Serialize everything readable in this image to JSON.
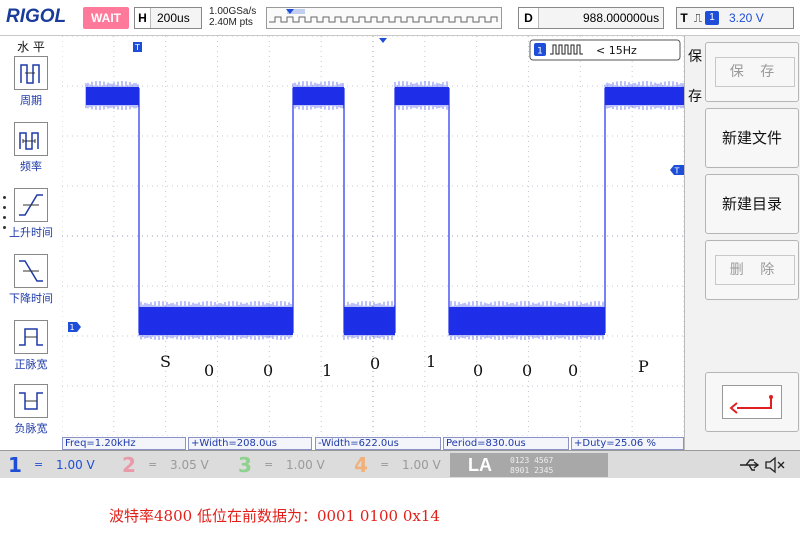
{
  "topbar": {
    "brand": "RIGOL",
    "status": "WAIT",
    "timebase_label": "H",
    "timebase_value": "200us",
    "sample_rate": "1.00GSa/s",
    "mem_depth": "2.40M pts",
    "delay_label": "D",
    "delay_value": "988.000000us",
    "trigger_label": "T",
    "trigger_channel": "1",
    "trigger_level": "3.20 V"
  },
  "left_menu": {
    "title": "水 平",
    "items": [
      {
        "label": "周期",
        "icon": "period-icon"
      },
      {
        "label": "频率",
        "icon": "frequency-icon"
      },
      {
        "label": "上升时间",
        "icon": "rise-time-icon"
      },
      {
        "label": "下降时间",
        "icon": "fall-time-icon"
      },
      {
        "label": "正脉宽",
        "icon": "positive-pulse-icon"
      },
      {
        "label": "负脉宽",
        "icon": "negative-pulse-icon"
      }
    ]
  },
  "screen": {
    "trigger_readout_channel": "1",
    "trigger_readout_text": "< 15Hz",
    "marker_ch1": "1",
    "marker_trigger": "T",
    "decode_chars": [
      "S",
      "0",
      "0",
      "1",
      "0",
      "1",
      "0",
      "0",
      "0",
      "P"
    ],
    "trace_color": "#1e2fe8"
  },
  "measurements": {
    "freq": "Freq=1.20kHz",
    "pwidth": "+Width=208.0us",
    "nwidth": "-Width=622.0us",
    "period": "Period=830.0us",
    "duty": "+Duty=25.06 %"
  },
  "right_menu": {
    "side_title_1": "保",
    "side_title_2": "存",
    "save": "保 存",
    "new_file": "新建文件",
    "new_dir": "新建目录",
    "delete": "删 除",
    "back_icon": "return-arrow-icon"
  },
  "channels": [
    {
      "num": "1",
      "coupling": "=",
      "scale": "1.00 V",
      "color": "#1e4ed8",
      "active": true
    },
    {
      "num": "2",
      "coupling": "=",
      "scale": "3.05 V",
      "color": "#e89aa8",
      "active": false
    },
    {
      "num": "3",
      "coupling": "=",
      "scale": "1.00 V",
      "color": "#8fd18f",
      "active": false
    },
    {
      "num": "4",
      "coupling": "=",
      "scale": "1.00 V",
      "color": "#f0b27a",
      "active": false
    }
  ],
  "la": {
    "label": "LA",
    "digits_row1": "0123 4567",
    "digits_row2": "8901 2345"
  },
  "status_icons": [
    "usb-icon",
    "speaker-mute-icon"
  ],
  "caption": "波特率4800  低位在前数据为：0001 0100 0x14"
}
